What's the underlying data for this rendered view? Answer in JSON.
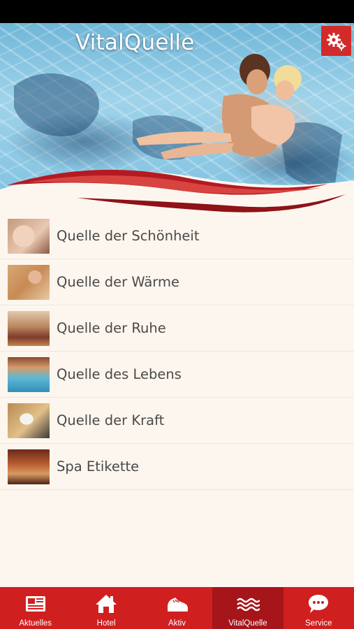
{
  "header": {
    "title": "VitalQuelle",
    "settings_icon": "settings-gears-icon"
  },
  "list": {
    "items": [
      {
        "label": "Quelle der Schönheit",
        "icon": "face-massage-thumbnail"
      },
      {
        "label": "Quelle der Wärme",
        "icon": "sauna-thumbnail"
      },
      {
        "label": "Quelle der Ruhe",
        "icon": "relaxation-room-thumbnail"
      },
      {
        "label": "Quelle des Lebens",
        "icon": "indoor-pool-thumbnail"
      },
      {
        "label": "Quelle der Kraft",
        "icon": "fitness-thumbnail"
      },
      {
        "label": "Spa Etikette",
        "icon": "spa-lounge-thumbnail"
      }
    ]
  },
  "tabbar": {
    "active": "VitalQuelle",
    "tabs": [
      {
        "label": "Aktuelles",
        "icon": "newspaper-icon"
      },
      {
        "label": "Hotel",
        "icon": "house-icon"
      },
      {
        "label": "Aktiv",
        "icon": "shoe-icon"
      },
      {
        "label": "VitalQuelle",
        "icon": "waves-icon"
      },
      {
        "label": "Service",
        "icon": "chat-bubble-icon"
      }
    ]
  },
  "colors": {
    "accent": "#d01f1f",
    "accent_active": "#a5151a",
    "background": "#fdf6ee",
    "text": "#4a4a4a"
  }
}
